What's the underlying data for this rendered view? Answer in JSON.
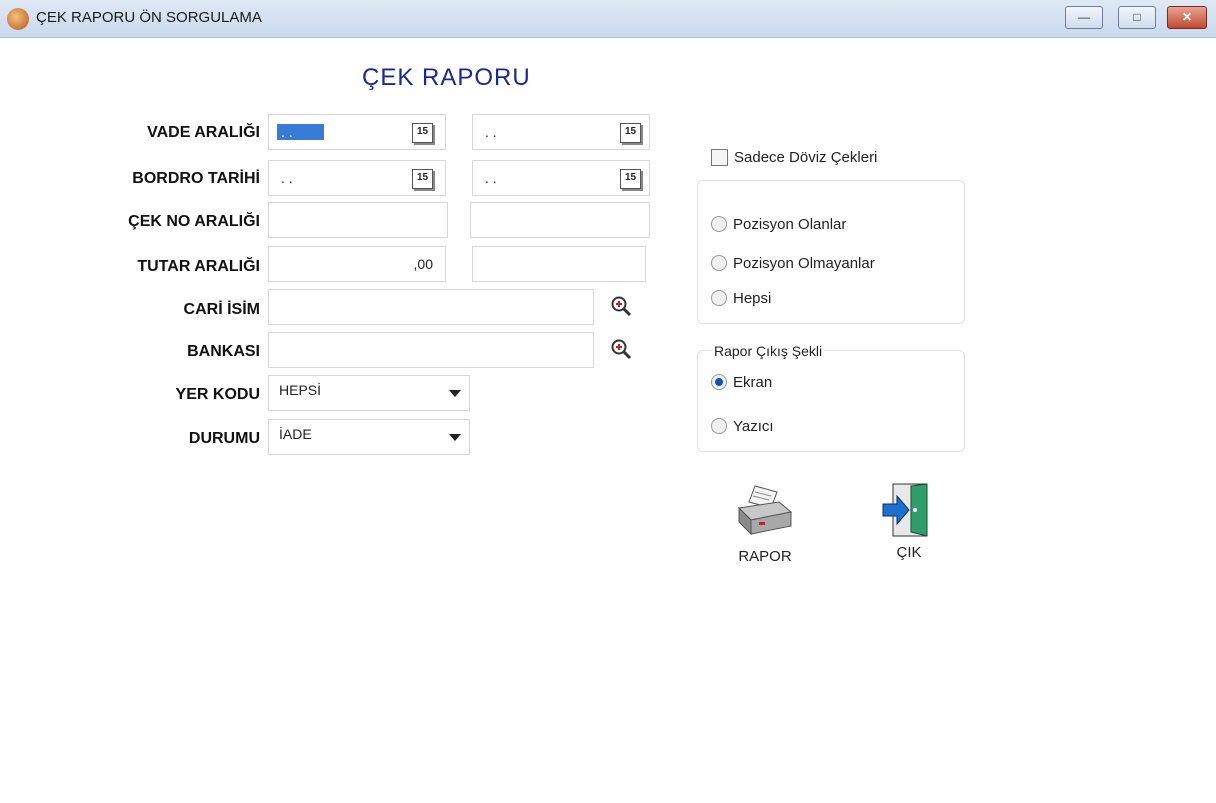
{
  "window": {
    "title": "ÇEK RAPORU ÖN SORGULAMA"
  },
  "heading": "ÇEK RAPORU",
  "form": {
    "vade_label": "VADE ARALIĞI",
    "vade_from": ". .",
    "vade_to": ". .",
    "bordro_label": "BORDRO TARİHİ",
    "bordro_from": ". .",
    "bordro_to": ". .",
    "cekno_label": "ÇEK NO ARALIĞI",
    "cekno_from": "",
    "cekno_to": "",
    "tutar_label": "TUTAR ARALIĞI",
    "tutar_from": ",00",
    "tutar_to": "",
    "cari_label": "CARİ İSİM",
    "cari_value": "",
    "bankasi_label": "BANKASI",
    "bankasi_value": "",
    "yerkodu_label": "YER KODU",
    "yerkodu_value": "HEPSİ",
    "durumu_label": "DURUMU",
    "durumu_value": "İADE",
    "calendar_glyph": "15"
  },
  "options": {
    "doviz_label": "Sadece Döviz Çekleri",
    "pozisyon_olanlar": "Pozisyon Olanlar",
    "pozisyon_olmayanlar": "Pozisyon Olmayanlar",
    "hepsi": "Hepsi",
    "cikis_legend": "Rapor Çıkış Şekli",
    "ekran": "Ekran",
    "yazici": "Yazıcı"
  },
  "buttons": {
    "rapor": "RAPOR",
    "cik": "ÇIK"
  }
}
